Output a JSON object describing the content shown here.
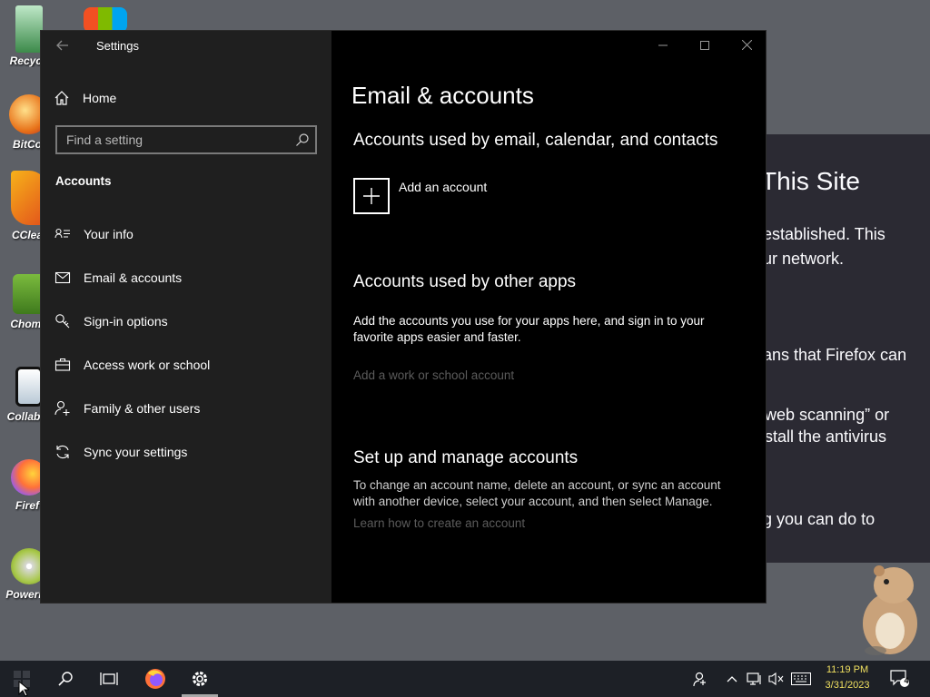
{
  "desktop": {
    "icons": [
      {
        "label": "Recycl",
        "icon": "recycle-bin-icon"
      },
      {
        "label": "BitCo",
        "icon": "bitcomet-icon"
      },
      {
        "label": "CClea",
        "icon": "ccleaner-icon"
      },
      {
        "label": "Chomi",
        "icon": "chomikbox-icon"
      },
      {
        "label": "CollabS",
        "icon": "collab-icon"
      },
      {
        "label": "Firef",
        "icon": "firefox-icon"
      },
      {
        "label": "PowerIS",
        "icon": "poweriso-icon"
      }
    ]
  },
  "background_browser": {
    "heading": "This Site",
    "lines": [
      "established. This",
      "ur network.",
      "ans that Firefox can",
      "web scanning” or",
      "stall the antivirus",
      "g you can do to"
    ]
  },
  "window": {
    "title": "Settings",
    "back_icon": "back-arrow-icon",
    "controls": [
      "minimize-icon",
      "maximize-icon",
      "close-icon"
    ]
  },
  "sidebar": {
    "home_label": "Home",
    "search_placeholder": "Find a setting",
    "section_label": "Accounts",
    "items": [
      {
        "label": "Your info",
        "icon": "person-card-icon"
      },
      {
        "label": "Email & accounts",
        "icon": "envelope-icon"
      },
      {
        "label": "Sign-in options",
        "icon": "key-icon"
      },
      {
        "label": "Access work or school",
        "icon": "briefcase-icon"
      },
      {
        "label": "Family & other users",
        "icon": "person-add-icon"
      },
      {
        "label": "Sync your settings",
        "icon": "sync-icon"
      }
    ]
  },
  "content": {
    "page_title": "Email & accounts",
    "section1_title": "Accounts used by email, calendar, and contacts",
    "add_account_label": "Add an account",
    "section2_title": "Accounts used by other apps",
    "section2_text": "Add the accounts you use for your apps here, and sign in to your favorite apps easier and faster.",
    "add_work_link": "Add a work or school account",
    "section3_title": "Set up and manage accounts",
    "section3_text": "To change an account name, delete an account, or sync an account with another device, select your account, and then select Manage.",
    "learn_link": "Learn how to create an account"
  },
  "taskbar": {
    "apps": [
      "start-icon",
      "search-icon",
      "task-view-icon",
      "firefox-icon",
      "settings-gear-icon"
    ],
    "tray": [
      "people-icon",
      "chevron-up-icon",
      "network-icon",
      "volume-muted-icon",
      "keyboard-icon"
    ],
    "time": "11:19 PM",
    "date": "3/31/2023",
    "notification_count": "4"
  },
  "colors": {
    "accent_clock": "#f0e060",
    "window_bg": "#000000",
    "sidebar_bg": "#1f1f1f"
  }
}
